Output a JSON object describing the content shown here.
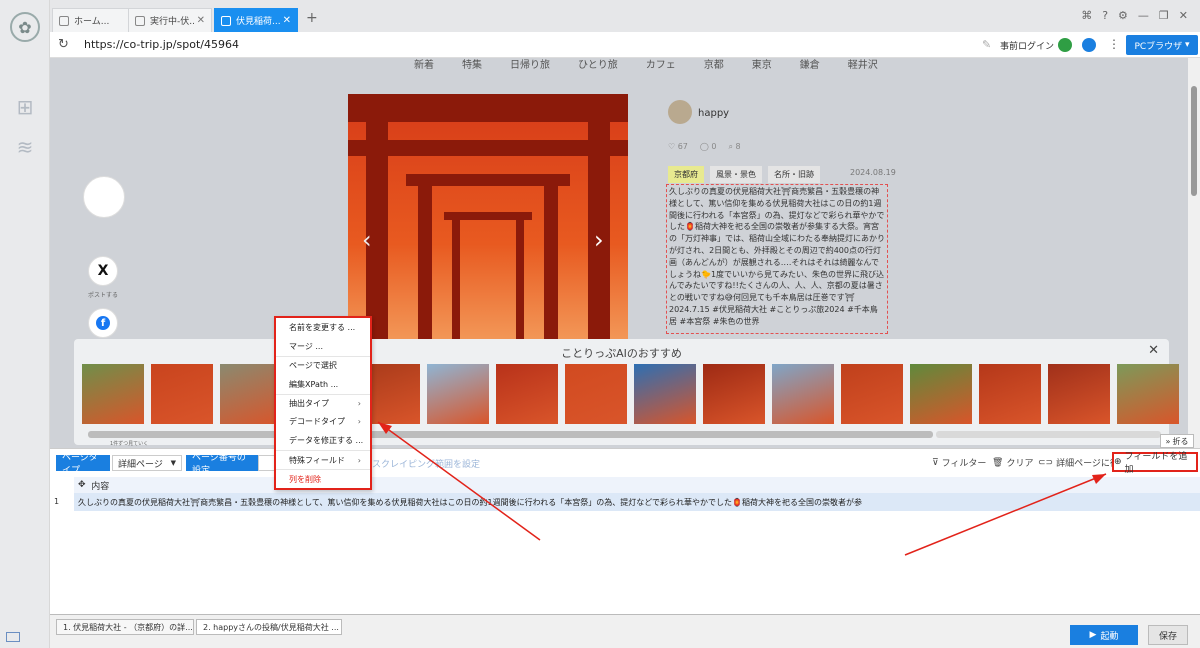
{
  "tabs": [
    {
      "label": "ホーム..."
    },
    {
      "label": "実行中-伏..."
    },
    {
      "label": "伏見稲荷..."
    }
  ],
  "address": {
    "url": "https://co-trip.jp/spot/45964",
    "login_label": "事前ログイン",
    "pc_browser_label": "PCブラウザ"
  },
  "site_nav": [
    "新着",
    "特集",
    "日帰り旅",
    "ひとり旅",
    "カフェ",
    "京都",
    "東京",
    "鎌倉",
    "軽井沢"
  ],
  "social": {
    "x_label": "ポストする"
  },
  "post": {
    "username": "happy",
    "likes": "67",
    "comments": "0",
    "clips": "8",
    "tags": [
      "京都府",
      "風景・景色",
      "名所・旧跡"
    ],
    "date": "2024.08.19",
    "text": "久しぶりの真夏の伏見稲荷大社⛩商売繁昌・五穀豊穣の神様として、篤い信仰を集める伏見稲荷大社はこの日の約1週間後に行われる「本宮祭」の為、提灯などで彩られ華やかでした🏮稲荷大神を祀る全国の崇敬者が参集する大祭。宵宮の「万灯神事」では、稲荷山全域にわたる奉納提灯にあかりが灯され、2日間とも、外拝殿とその周辺で約400点の行灯画（あんどんが）が展観される‥‥それはそれは綺麗なんでしょうね🐤1度でいいから見てみたい、朱色の世界に飛び込んでみたいですね!!たくさんの人、人、人、京都の夏は暑さとの戦いですね😅何回見ても千本鳥居は圧巻です⛩ 2024.7.15 #伏見稲荷大社 #ことりっぷ旅2024 #千本鳥居 #本宮祭 #朱色の世界"
  },
  "reco": {
    "title": "ことりっぷAIのおすすめ",
    "tiny_caption": "1件ずつ見ていく",
    "thumb_count": 16
  },
  "context_menu": {
    "items": [
      {
        "label": "名前を変更する ..."
      },
      {
        "label": "マージ ..."
      },
      {
        "label": "ページで選択"
      },
      {
        "label": "編集XPath ..."
      },
      {
        "label": "抽出タイプ"
      },
      {
        "label": "デコードタイプ"
      },
      {
        "label": "データを修正する ..."
      },
      {
        "label": "特殊フィールド"
      },
      {
        "label": "列を削除"
      }
    ]
  },
  "toolbar": {
    "page_type_label": "ページタイプ",
    "page_type_value": "詳細ページ",
    "page_number_label": "ページ番号の設定",
    "scrape_range_label": "スクレイピング範囲を設定",
    "filter_label": "フィルター",
    "clear_label": "クリア",
    "goto_detail_label": "詳細ページに行く",
    "add_field_label": "フィールドを追加",
    "fold_label": "折る"
  },
  "table": {
    "column": "内容",
    "rows": [
      {
        "num": "1",
        "content": "久しぶりの真夏の伏見稲荷大社⛩商売繁昌・五穀豊穣の神様として、篤い信仰を集める伏見稲荷大社はこの日の約1週間後に行われる「本宮祭」の為、提灯などで彩られ華やかでした🏮稲荷大神を祀る全国の崇敬者が参"
      }
    ]
  },
  "bottom_tabs": [
    {
      "label": "1. 伏見稲荷大社 - （京都府）の詳..."
    },
    {
      "label": "2. happyさんの投稿/伏見稲荷大社 ..."
    }
  ],
  "actions": {
    "run_label": "起動",
    "save_label": "保存"
  },
  "colors": {
    "accent": "#1a7fe0",
    "highlight": "#e2231a"
  }
}
